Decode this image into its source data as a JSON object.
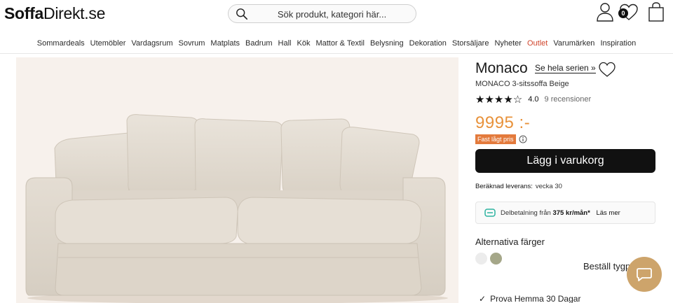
{
  "header": {
    "logo_bold": "Soffa",
    "logo_light": "Direkt.se",
    "search_placeholder": "Sök produkt, kategori här...",
    "wishlist_count": "0",
    "icons": [
      "search-icon",
      "user-icon",
      "heart-icon",
      "shopping-bag-icon"
    ]
  },
  "nav": {
    "items": [
      {
        "label": "Sommardeals"
      },
      {
        "label": "Utemöbler"
      },
      {
        "label": "Vardagsrum"
      },
      {
        "label": "Sovrum"
      },
      {
        "label": "Matplats"
      },
      {
        "label": "Badrum"
      },
      {
        "label": "Hall"
      },
      {
        "label": "Kök"
      },
      {
        "label": "Mattor & Textil"
      },
      {
        "label": "Belysning"
      },
      {
        "label": "Dekoration"
      },
      {
        "label": "Storsäljare"
      },
      {
        "label": "Nyheter"
      },
      {
        "label": "Outlet"
      },
      {
        "label": "Varumärken"
      },
      {
        "label": "Inspiration"
      }
    ],
    "outlet_color": "#d0452c"
  },
  "product": {
    "title": "Monaco",
    "series_link": "Se hela serien »",
    "subtitle": "MONACO 3-sitssoffa Beige",
    "stars": "★★★★☆",
    "rating_value": "4.0",
    "reviews": "9 recensioner",
    "price": "9995 :-",
    "price_color": "#e8923b",
    "badge": "Fast lågt pris",
    "add_to_cart": "Lägg i varukorg",
    "delivery_label": "Beräknad leverans:",
    "delivery_week": "vecka 30",
    "installment_prefix": "Delbetalning från",
    "installment_amount": "375 kr/mån*",
    "installment_read_more": "Läs mer",
    "alt_colors_title": "Alternativa färger",
    "swatches": [
      "#ececec",
      "#a5a789"
    ],
    "order_fabric": "Beställ tygprov",
    "try_home": "Prova Hemma 30 Dagar"
  },
  "chat": {
    "accent": "#cda46b"
  }
}
